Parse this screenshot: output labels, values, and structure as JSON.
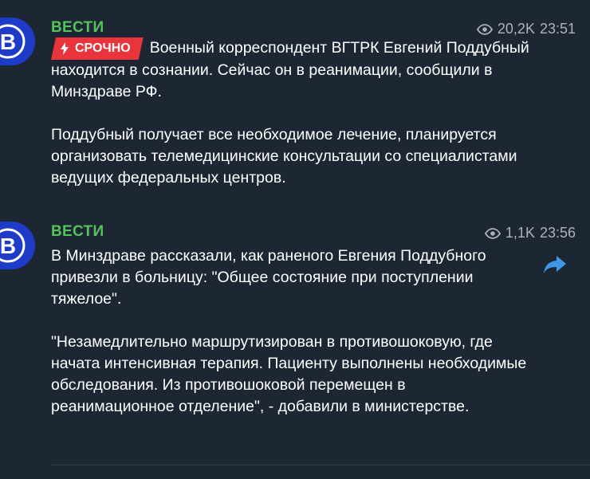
{
  "messages": [
    {
      "sender": "ВЕСТИ",
      "avatar_letter": "В",
      "views": "20,2K",
      "time": "23:51",
      "badge": "СРОЧНО",
      "first_line": "Военный корреспондент ВГТРК Евгений Поддубный находится в сознании. Сейчас он в реанимации, сообщили в Минздраве РФ.",
      "paragraph_2": "Поддубный получает все необходимое лечение, планируется организовать телемедицинские консультации со специалистами ведущих федеральных центров."
    },
    {
      "sender": "ВЕСТИ",
      "avatar_letter": "В",
      "views": "1,1K",
      "time": "23:56",
      "paragraph_1": "В Минздраве рассказали, как раненого Евгения Поддубного привезли в больницу: \"Общее состояние при поступлении тяжелое\".",
      "paragraph_2": "\"Незамедлительно маршрутизирован в противошоковую, где начата интенсивная терапия. Пациенту выполнены необходимые обследования. Из противошоковой перемещен в реанимационное отделение\", - добавили в министерстве."
    }
  ],
  "colors": {
    "background": "#1d2733",
    "sender": "#55c25b",
    "badge": "#e8343a",
    "avatar": "#1f3cc9",
    "meta": "#aab3bd",
    "share": "#3e97e8"
  },
  "icons": {
    "views": "eye-icon",
    "share": "share-arrow-icon",
    "badge": "lightning-icon"
  }
}
